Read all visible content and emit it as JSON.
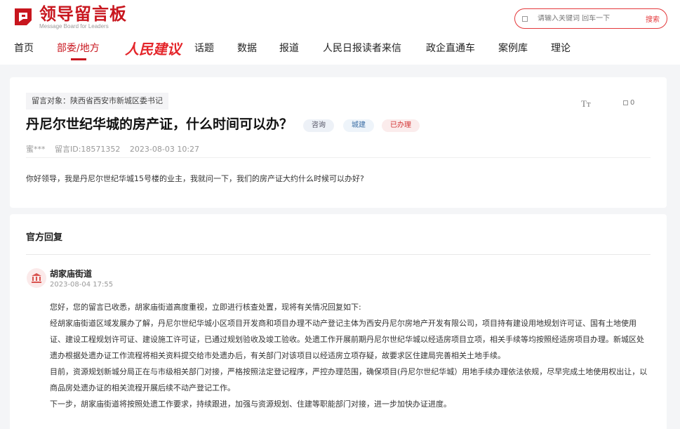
{
  "brand": {
    "name_cn": "领导留言板",
    "name_en": "Message Board for Leaders"
  },
  "search": {
    "placeholder": "请输入关键词 回车一下",
    "button": "搜索"
  },
  "nav": {
    "items": [
      "首页",
      "部委/地方",
      "话题",
      "数据",
      "报道",
      "人民日报读者来信",
      "政企直通车",
      "案例库",
      "理论"
    ],
    "brand_item": "人民建议",
    "active": "部委/地方"
  },
  "message": {
    "target": "留言对象：陕西省西安市新城区委书记",
    "title": "丹尼尔世纪华城的房产证，什么时间可以办？",
    "tags": [
      "咨询",
      "城建",
      "已办理"
    ],
    "author": "蜜***",
    "id_label": "留言ID:18571352",
    "time": "2023-08-03 10:27",
    "content": "你好领导，我是丹尼尔世纪华城15号楼的业主，我就问一下，我们的房产证大约什么时候可以办好?",
    "font_label": "Tт",
    "fav_count": "0"
  },
  "reply": {
    "section_title": "官方回复",
    "org": "胡家庙街道",
    "time": "2023-08-04 17:55",
    "paragraphs": [
      "您好，您的留言已收悉，胡家庙街道高度重视，立即进行核查处置，现将有关情况回复如下:",
      "经胡家庙街道区域发展办了解，丹尼尔世纪华城小区项目开发商和项目办理不动产登记主体为西安丹尼尔房地产开发有限公司，项目持有建设用地规划许可证、国有土地使用证、建设工程规划许可证、建设施工许可证，已通过规划验收及竣工验收。处遗工作开展前期丹尼尔世纪华城以经适房项目立项，相关手续等均按照经适房项目办理。新城区处遗办根据处遗办证工作流程将相关资料提交给市处遗办后，有关部门对该项目以经适房立项存疑，故要求区住建局完善相关土地手续。",
      "目前，资源规划新城分局正在与市级相关部门对接，严格按照法定登记程序，严控办理范围，确保项目(丹尼尔世纪华城）用地手续办理依法依规，尽早完成土地使用权出让，以商品房处遗办证的相关流程开展后续不动产登记工作。",
      "下一步，胡家庙街道将按照处遗工作要求，持续跟进，加强与资源规划、住建等职能部门对接，进一步加快办证进度。"
    ]
  },
  "colors": {
    "accent": "#c8161e",
    "tag_done": "#d23232",
    "tag_city": "#3b6ea5"
  }
}
